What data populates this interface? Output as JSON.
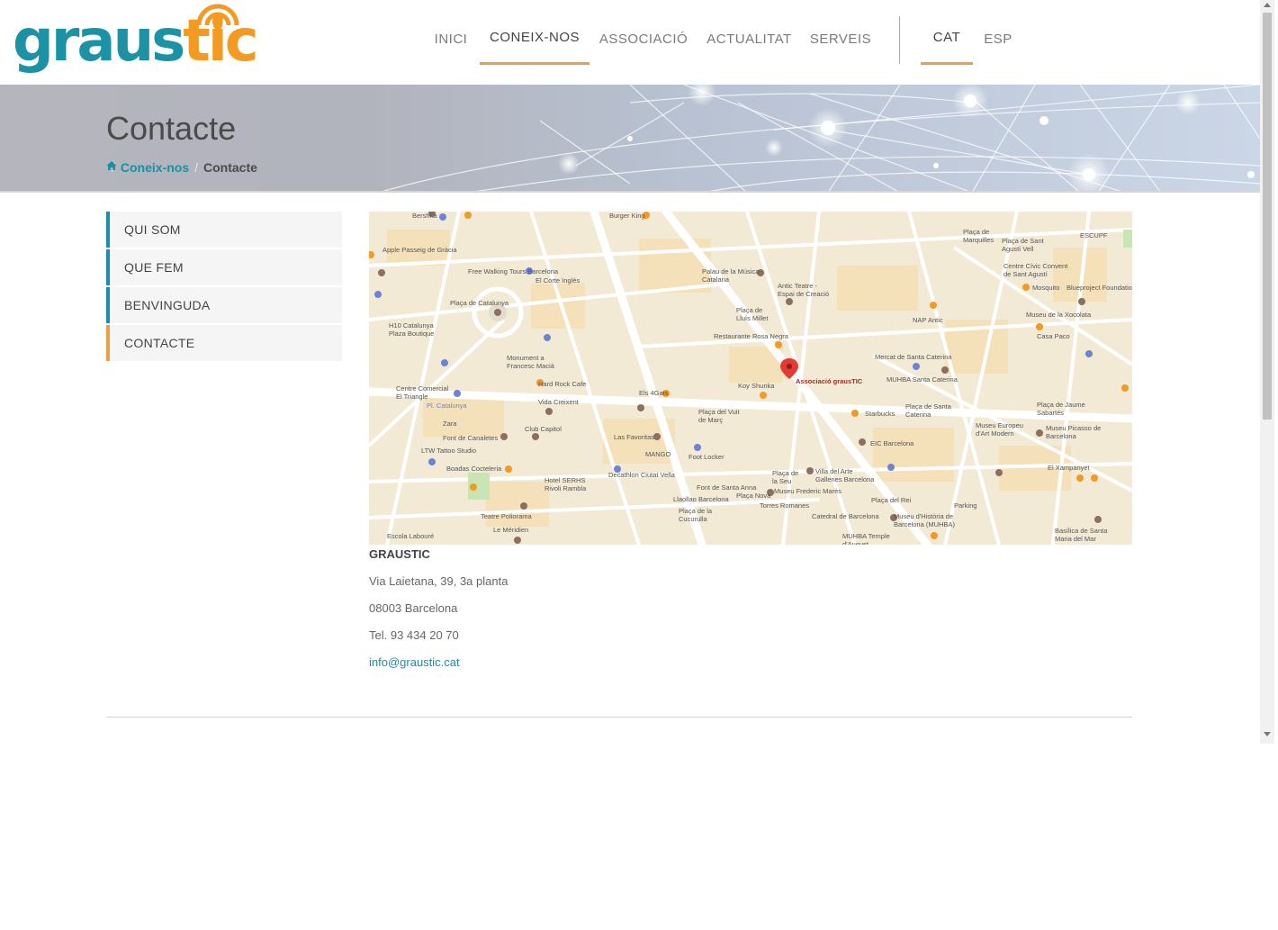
{
  "brand": {
    "logo_part1": "graus",
    "logo_part2": "tic",
    "teal": "#1b93a5",
    "orange": "#f29a21"
  },
  "nav": {
    "items": [
      {
        "label": "INICI",
        "active": false
      },
      {
        "label": "CONEIX-NOS",
        "active": true
      },
      {
        "label": "ASSOCIACIÓ",
        "active": false
      },
      {
        "label": "ACTUALITAT",
        "active": false
      },
      {
        "label": "SERVEIS",
        "active": false
      }
    ],
    "languages": [
      {
        "label": "CAT",
        "active": true
      },
      {
        "label": "ESP",
        "active": false
      }
    ]
  },
  "banner": {
    "title": "Contacte",
    "breadcrumb": {
      "home_icon": "home-icon",
      "parent": "Coneix-nos",
      "current": "Contacte",
      "separator": "/"
    }
  },
  "sidebar": {
    "items": [
      {
        "label": "QUI SOM",
        "active": false
      },
      {
        "label": "QUE FEM",
        "active": false
      },
      {
        "label": "BENVINGUDA",
        "active": false
      },
      {
        "label": "CONTACTE",
        "active": true
      }
    ]
  },
  "map": {
    "marker_label": "Associació grausTIC",
    "labels": [
      "Bershka",
      "Burger King",
      "Apple Passeig de Gràcia",
      "Free Walking Tours Barcelona",
      "El Corte Inglés",
      "Plaça de Catalunya",
      "H10 Catalunya Plaza Boutique",
      "Palau de la Música Catalana",
      "Antic Teatre - Espai de Creació",
      "Plaça de Lluís Millet",
      "Restaurante Rosa Negra",
      "Plaça de Marquilles",
      "Plaça de Sant Agustí Vell",
      "ESCUPF",
      "Centre Cívic Convent de Sant Agustí",
      "Mosquito",
      "Blueproject Foundation",
      "NAP Antic",
      "Museu de la Xocolata",
      "Casa Paco",
      "Mercat de Santa Caterina",
      "MUHBA Santa Caterina",
      "Monument a Francesc Macià",
      "Hard Rock Cafe",
      "Centre Comercial El Triangle",
      "Pl. Catalunya",
      "Vida Creixent",
      "Els 4Gats",
      "Koy Shunka",
      "Starbucks",
      "Plaça de Santa Caterina",
      "Plaça de Jaume Sabartés",
      "Zara",
      "Font de Canaletes",
      "Club Capitol",
      "Las Favoritas",
      "Plaça del Vuit de Març",
      "EIC Barcelona",
      "Museu Europeu d'Art Modern",
      "Museu Picasso de Barcelona",
      "LTW Tattoo Studio",
      "MANGO",
      "Foot Locker",
      "Boadas Cocteleria",
      "Decathlon Ciutat Vella",
      "Hotel SERHS Rivoli Rambla",
      "Font de Santa Anna",
      "Plaça de la Seu",
      "Villa del Arte Galleries Barcelona",
      "Museu Frederic Marès",
      "El Xampanyet",
      "Llaollao Barcelona",
      "Plaça Nova",
      "Plaça del Rei",
      "Teatre Poliorama",
      "Plaça de la Cucurulla",
      "Torres Romanes",
      "Catedral de Barcelona",
      "Museu d'Història de Barcelona (MUHBA)",
      "Parking",
      "Escola Labouré",
      "Le Méridien",
      "MUHBA Temple d'August",
      "Basílica de Santa Maria del Mar"
    ]
  },
  "contact": {
    "name": "GRAUSTIC",
    "address": "Via Laietana, 39, 3a planta",
    "city": "08003 Barcelona",
    "phone": "Tel. 93 434 20 70",
    "email": "info@graustic.cat"
  }
}
